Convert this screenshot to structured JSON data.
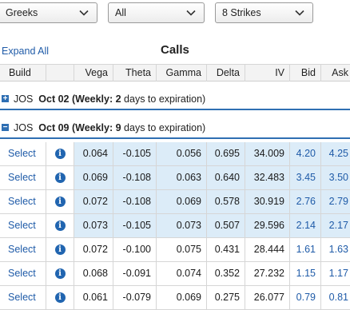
{
  "filters": {
    "greeks": "Greeks",
    "type": "All",
    "strikes": "8 Strikes"
  },
  "toolbar": {
    "expand_all": "Expand All",
    "section_title": "Calls"
  },
  "columns": [
    "Build",
    "",
    "Vega",
    "Theta",
    "Gamma",
    "Delta",
    "IV",
    "Bid",
    "Ask"
  ],
  "expiries": [
    {
      "toggle": "+",
      "symbol": "JOS",
      "date": "Oct 02",
      "prefix": "(Weekly: ",
      "days": "2",
      "suffix": " days to expiration)"
    },
    {
      "toggle": "−",
      "symbol": "JOS",
      "date": "Oct 09",
      "prefix": "(Weekly: ",
      "days": "9",
      "suffix": " days to expiration)"
    }
  ],
  "rows": [
    {
      "build": "Select",
      "vega": "0.064",
      "theta": "-0.105",
      "gamma": "0.056",
      "delta": "0.695",
      "iv": "34.009",
      "bid": "4.20",
      "ask": "4.25",
      "itm": true
    },
    {
      "build": "Select",
      "vega": "0.069",
      "theta": "-0.108",
      "gamma": "0.063",
      "delta": "0.640",
      "iv": "32.483",
      "bid": "3.45",
      "ask": "3.50",
      "itm": true
    },
    {
      "build": "Select",
      "vega": "0.072",
      "theta": "-0.108",
      "gamma": "0.069",
      "delta": "0.578",
      "iv": "30.919",
      "bid": "2.76",
      "ask": "2.79",
      "itm": true
    },
    {
      "build": "Select",
      "vega": "0.073",
      "theta": "-0.105",
      "gamma": "0.073",
      "delta": "0.507",
      "iv": "29.596",
      "bid": "2.14",
      "ask": "2.17",
      "itm": true
    },
    {
      "build": "Select",
      "vega": "0.072",
      "theta": "-0.100",
      "gamma": "0.075",
      "delta": "0.431",
      "iv": "28.444",
      "bid": "1.61",
      "ask": "1.63",
      "itm": false
    },
    {
      "build": "Select",
      "vega": "0.068",
      "theta": "-0.091",
      "gamma": "0.074",
      "delta": "0.352",
      "iv": "27.232",
      "bid": "1.15",
      "ask": "1.17",
      "itm": false
    },
    {
      "build": "Select",
      "vega": "0.061",
      "theta": "-0.079",
      "gamma": "0.069",
      "delta": "0.275",
      "iv": "26.077",
      "bid": "0.79",
      "ask": "0.81",
      "itm": false
    }
  ],
  "colors": {
    "accent": "#2f6fb3",
    "itm_shade": "#dcecf8",
    "link": "#1f5ba8"
  },
  "icons": {
    "dropdown": "chevron-down-icon",
    "info": "info-icon"
  }
}
